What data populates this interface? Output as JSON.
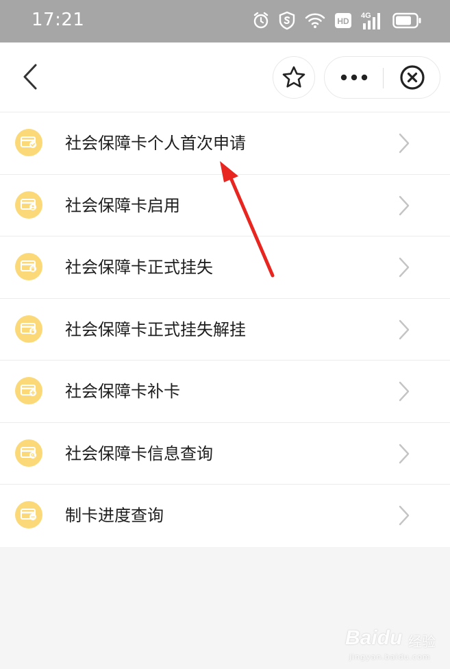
{
  "status_bar": {
    "time": "17:21",
    "icons": [
      "alarm-icon",
      "shield-icon",
      "wifi-icon",
      "hd-icon",
      "signal-4g-icon",
      "battery-icon"
    ],
    "hd_label": "HD",
    "network_label": "4G"
  },
  "header": {
    "back_icon": "chevron-left-icon",
    "favorite_icon": "star-icon",
    "more_icon": "more-dots-icon",
    "close_icon": "close-circle-icon"
  },
  "menu": {
    "items": [
      {
        "label": "社会保障卡个人首次申请",
        "icon": "card-check-icon"
      },
      {
        "label": "社会保障卡启用",
        "icon": "card-user-icon"
      },
      {
        "label": "社会保障卡正式挂失",
        "icon": "card-lock-icon"
      },
      {
        "label": "社会保障卡正式挂失解挂",
        "icon": "card-unlock-icon"
      },
      {
        "label": "社会保障卡补卡",
        "icon": "card-add-icon"
      },
      {
        "label": "社会保障卡信息查询",
        "icon": "card-search-icon"
      },
      {
        "label": "制卡进度查询",
        "icon": "card-progress-icon"
      }
    ]
  },
  "watermark": {
    "brand": "Baidu",
    "sub": "经验",
    "url": "jingyan.baidu.com"
  },
  "colors": {
    "status_bar_bg": "#a6a6a6",
    "icon_bg": "#fcd978",
    "arrow": "#e8251f",
    "text": "#1e1e1e",
    "chevron": "#c4c4c4"
  }
}
